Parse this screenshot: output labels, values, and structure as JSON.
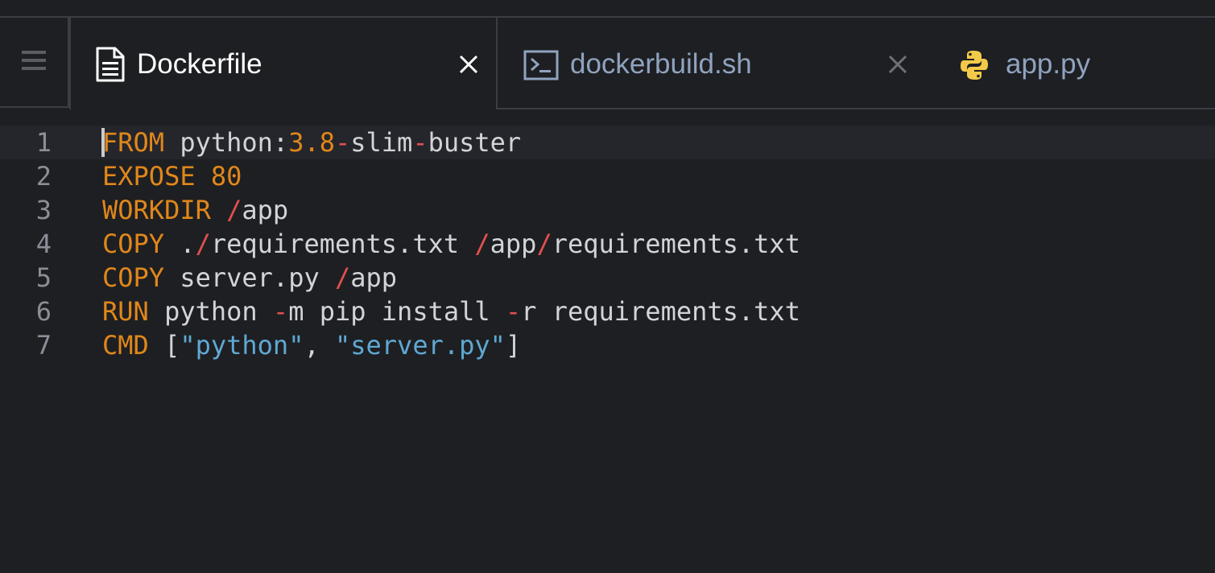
{
  "tabs": [
    {
      "label": "Dockerfile",
      "icon": "document-icon",
      "active": true,
      "close": "×"
    },
    {
      "label": "dockerbuild.sh",
      "icon": "terminal-icon",
      "active": false,
      "close": "×"
    },
    {
      "label": "app.py",
      "icon": "python-icon",
      "active": false
    }
  ],
  "menu": {
    "icon": "hamburger-menu-icon"
  },
  "editor": {
    "current_line": 1,
    "lines": [
      {
        "number": "1",
        "tokens": [
          [
            "kw",
            "FROM"
          ],
          [
            "txt",
            " python:"
          ],
          [
            "num",
            "3.8"
          ],
          [
            "op",
            "-"
          ],
          [
            "txt",
            "slim"
          ],
          [
            "op",
            "-"
          ],
          [
            "txt",
            "buster"
          ]
        ]
      },
      {
        "number": "2",
        "tokens": [
          [
            "kw",
            "EXPOSE"
          ],
          [
            "txt",
            " "
          ],
          [
            "num",
            "80"
          ]
        ]
      },
      {
        "number": "3",
        "tokens": [
          [
            "kw",
            "WORKDIR"
          ],
          [
            "txt",
            " "
          ],
          [
            "op",
            "/"
          ],
          [
            "txt",
            "app"
          ]
        ]
      },
      {
        "number": "4",
        "tokens": [
          [
            "kw",
            "COPY"
          ],
          [
            "txt",
            " ."
          ],
          [
            "op",
            "/"
          ],
          [
            "txt",
            "requirements.txt "
          ],
          [
            "op",
            "/"
          ],
          [
            "txt",
            "app"
          ],
          [
            "op",
            "/"
          ],
          [
            "txt",
            "requirements.txt"
          ]
        ]
      },
      {
        "number": "5",
        "tokens": [
          [
            "kw",
            "COPY"
          ],
          [
            "txt",
            " server.py "
          ],
          [
            "op",
            "/"
          ],
          [
            "txt",
            "app"
          ]
        ]
      },
      {
        "number": "6",
        "tokens": [
          [
            "kw",
            "RUN"
          ],
          [
            "txt",
            " python "
          ],
          [
            "op",
            "-"
          ],
          [
            "txt",
            "m pip install "
          ],
          [
            "op",
            "-"
          ],
          [
            "txt",
            "r requirements.txt"
          ]
        ]
      },
      {
        "number": "7",
        "tokens": [
          [
            "kw",
            "CMD"
          ],
          [
            "txt",
            " ["
          ],
          [
            "str",
            "\"python\""
          ],
          [
            "txt",
            ", "
          ],
          [
            "str",
            "\"server.py\""
          ],
          [
            "txt",
            "]"
          ]
        ]
      }
    ]
  },
  "colors": {
    "background": "#1e1f22",
    "keyword": "#e0871b",
    "operator": "#e0514f",
    "string": "#5fa8d3",
    "text": "#d2d4d8",
    "tab_active_text": "#ffffff",
    "tab_inactive_text": "#8fa3bf"
  }
}
